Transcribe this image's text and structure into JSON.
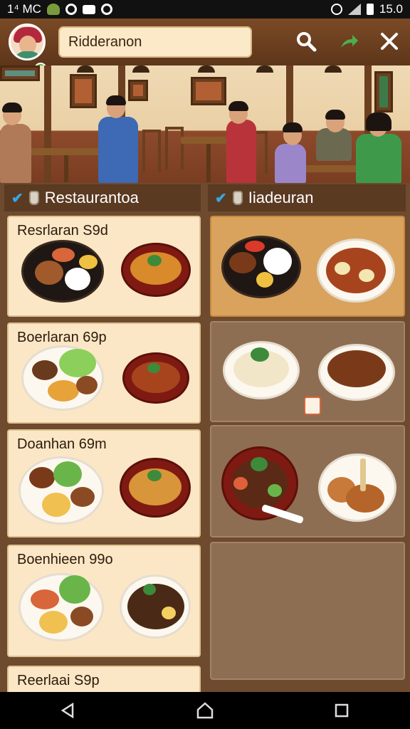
{
  "status_bar": {
    "left_text": "1⁴ MC",
    "time": "15.0",
    "icons": [
      "leaf-icon",
      "circle-icon",
      "mail-icon",
      "sync-icon",
      "alarm-icon",
      "signal-icon",
      "battery-icon"
    ]
  },
  "header": {
    "search_value": "Ridderanon",
    "icons": [
      "avatar",
      "search-icon",
      "share-icon",
      "close-icon"
    ],
    "colors": {
      "bar": "#6b4020",
      "search_bg": "#fbe9c8"
    }
  },
  "columns": {
    "left": {
      "label": "Restaurantoa"
    },
    "right": {
      "label": "Iiadeuran"
    }
  },
  "left_cards": [
    {
      "title": "Resrlaran S9d"
    },
    {
      "title": "Boerlaran 69p"
    },
    {
      "title": "Doanhan 69m"
    },
    {
      "title": "Boenhieen 99o"
    },
    {
      "title": "Reerlaai S9p"
    }
  ],
  "right_cards": [
    {
      "highlight": true
    },
    {
      "highlight": false,
      "badge": "recipe-badge-icon"
    },
    {
      "highlight": false
    },
    {
      "highlight": false
    }
  ],
  "nav_bar": {
    "icons": [
      "back-icon",
      "home-icon",
      "recents-icon"
    ]
  }
}
